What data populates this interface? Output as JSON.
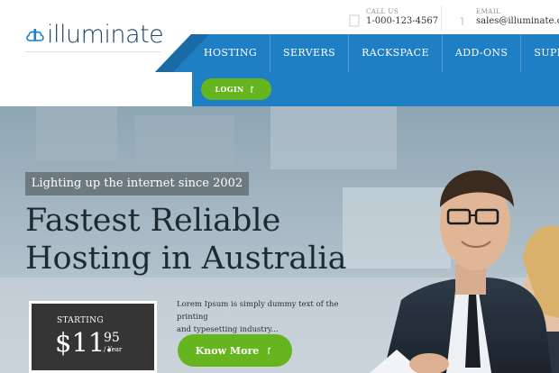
{
  "brand": {
    "name": "illuminate",
    "logo_icon": "cloud-icon",
    "accent": "#1f7fc4",
    "green": "#67b51e"
  },
  "contact": {
    "phone_label": "CALL US",
    "phone": "1-000-123-4567",
    "email_label": "EMAIL",
    "email": "sales@illuminate.co"
  },
  "nav": {
    "items": [
      "HOSTING",
      "SERVERS",
      "RACKSPACE",
      "ADD-ONS",
      "SUPPORT"
    ],
    "login": "LOGIN"
  },
  "hero": {
    "tagline": "Lighting up the internet since 2002",
    "headline_line1": "Fastest Reliable",
    "headline_line2": "Hosting in Australia",
    "price_label": "STARTING",
    "price_whole": "$11.",
    "price_cents": "95",
    "price_period": "/ Year",
    "description_line1": "Lorem Ipsum is simply dummy text of the printing",
    "description_line2": "and typesetting industry...",
    "cta": "Know More"
  }
}
